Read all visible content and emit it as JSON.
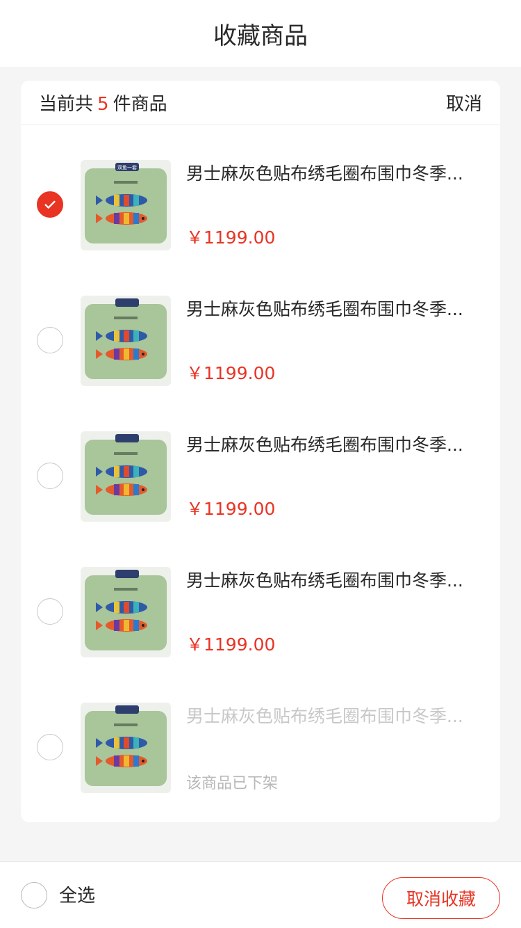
{
  "header": {
    "title": "收藏商品"
  },
  "summary": {
    "prefix": "当前共",
    "count": "5",
    "suffix": "件商品",
    "cancel_label": "取消"
  },
  "items": [
    {
      "title": "男士麻灰色贴布绣毛圈布围巾冬季...",
      "price": "￥1199.00",
      "checked": true,
      "status": ""
    },
    {
      "title": "男士麻灰色贴布绣毛圈布围巾冬季...",
      "price": "￥1199.00",
      "checked": false,
      "status": ""
    },
    {
      "title": "男士麻灰色贴布绣毛圈布围巾冬季...",
      "price": "￥1199.00",
      "checked": false,
      "status": ""
    },
    {
      "title": "男士麻灰色贴布绣毛圈布围巾冬季...",
      "price": "￥1199.00",
      "checked": false,
      "status": ""
    },
    {
      "title": "男士麻灰色贴布绣毛圈布围巾冬季...",
      "price": "",
      "checked": false,
      "status": "该商品已下架"
    }
  ],
  "footer": {
    "select_all_label": "全选",
    "unfavorite_label": "取消收藏"
  },
  "colors": {
    "accent": "#e93323",
    "pillow": "#a9c59a"
  },
  "icons": {
    "check": "check-icon",
    "thumb_badge": "双鱼一套"
  }
}
